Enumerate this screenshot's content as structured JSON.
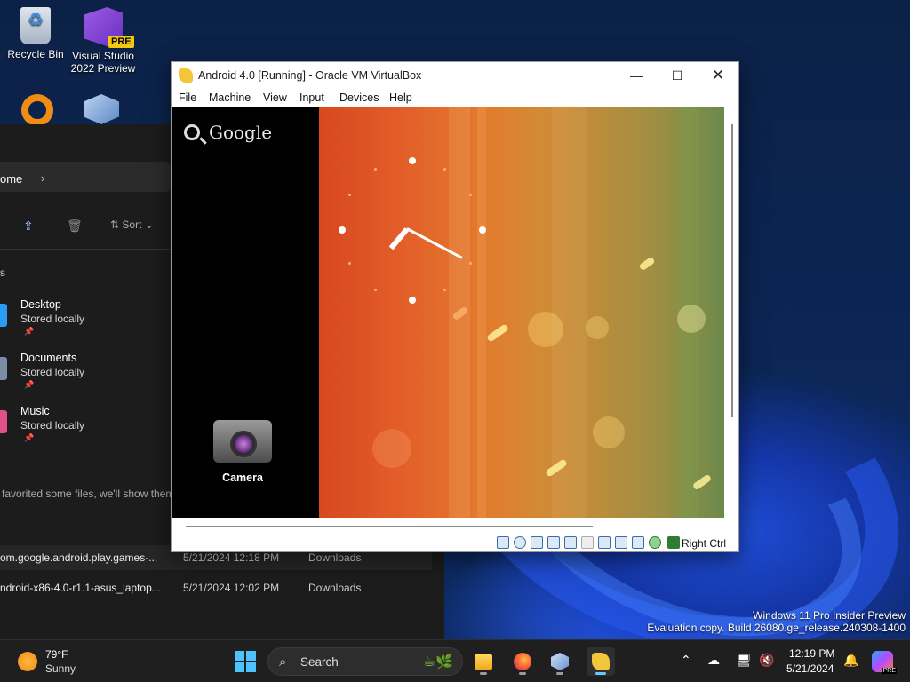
{
  "desktop": {
    "icons": [
      {
        "label": "Recycle Bin"
      },
      {
        "label": "Visual Studio 2022 Preview",
        "badge": "PRE"
      }
    ]
  },
  "explorer": {
    "address_tail": "ome",
    "sort_label": "Sort",
    "section_fragment": "s",
    "quick_access": [
      {
        "name": "Desktop",
        "status": "Stored locally",
        "color": "#2b9bf4"
      },
      {
        "name": "Documents",
        "status": "Stored locally",
        "color": "#7a8fa6"
      },
      {
        "name": "Music",
        "status": "Stored locally",
        "color": "#e0508a"
      }
    ],
    "favorites_note": "favorited some files, we'll show them",
    "files": [
      {
        "name": "om.google.android.play.games-...",
        "date": "5/21/2024 12:18 PM",
        "location": "Downloads"
      },
      {
        "name": "ndroid-x86-4.0-r1.1-asus_laptop...",
        "date": "5/21/2024 12:02 PM",
        "location": "Downloads"
      }
    ]
  },
  "vbox": {
    "title": "Android 4.0 [Running] - Oracle VM VirtualBox",
    "menu": [
      "File",
      "Machine",
      "View",
      "Input",
      "Devices",
      "Help"
    ],
    "host_key": "Right Ctrl",
    "android": {
      "search_label": "Google",
      "app_label": "Camera"
    }
  },
  "watermark": {
    "line1": "Windows 11 Pro Insider Preview",
    "line2": "Evaluation copy. Build 26080.ge_release.240308-1400"
  },
  "taskbar": {
    "weather_temp": "79°F",
    "weather_desc": "Sunny",
    "search_placeholder": "Search",
    "time": "12:19 PM",
    "date": "5/21/2024",
    "copilot_badge": "PRE",
    "apps": [
      "file-explorer",
      "firefox",
      "virtualbox",
      "virtualbox-vm"
    ]
  },
  "colors": {
    "accent": "#60cdff",
    "start": "#4cc2ff",
    "taskbar_bg": "#1f1f1f"
  }
}
